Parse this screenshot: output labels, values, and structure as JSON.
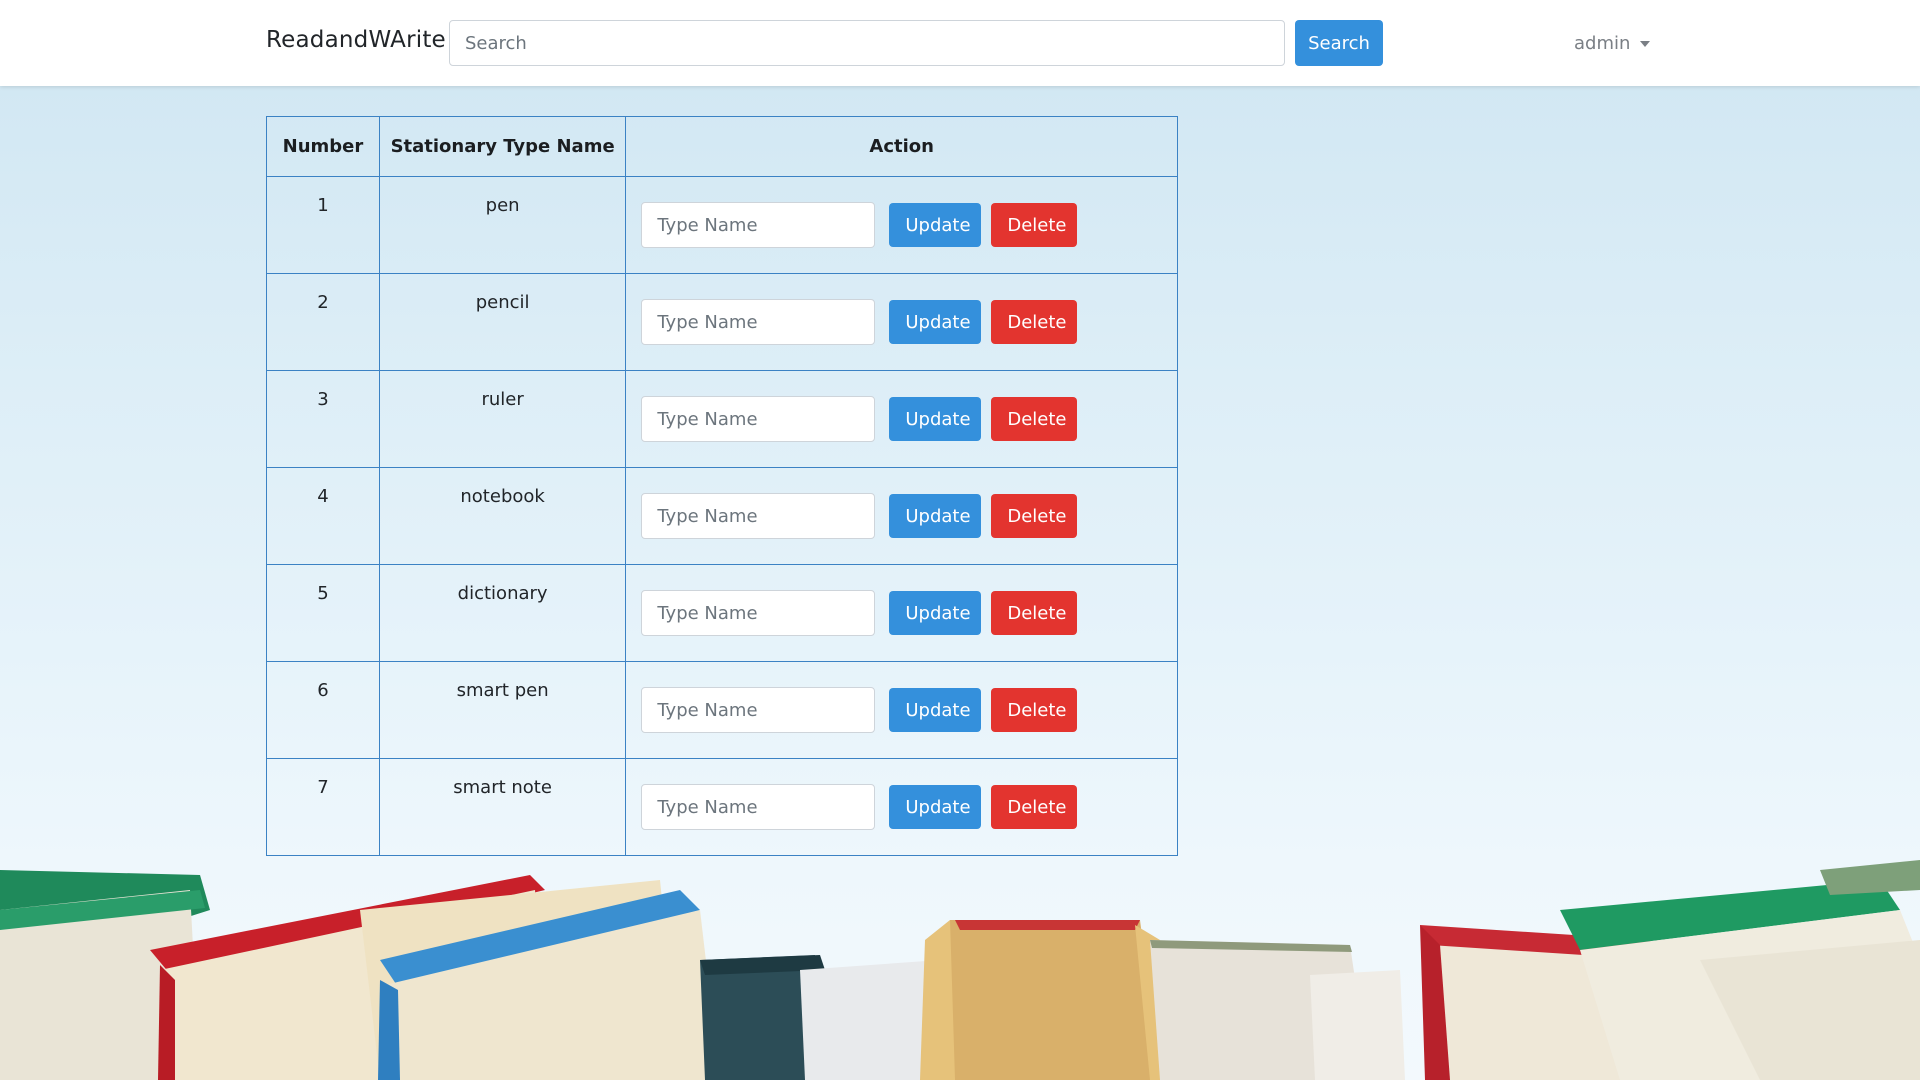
{
  "navbar": {
    "brand": "ReadandWArite",
    "search_placeholder": "Search",
    "search_button": "Search",
    "user": "admin"
  },
  "table": {
    "headers": [
      "Number",
      "Stationary Type Name",
      "Action"
    ],
    "input_placeholder": "Type Name",
    "update_label": "Update",
    "delete_label": "Delete",
    "rows": [
      {
        "number": "1",
        "name": "pen"
      },
      {
        "number": "2",
        "name": "pencil"
      },
      {
        "number": "3",
        "name": "ruler"
      },
      {
        "number": "4",
        "name": "notebook"
      },
      {
        "number": "5",
        "name": "dictionary"
      },
      {
        "number": "6",
        "name": "smart pen"
      },
      {
        "number": "7",
        "name": "smart note"
      }
    ]
  },
  "colors": {
    "primary": "#3490dc",
    "danger": "#e3342f",
    "border": "#3b82c4"
  }
}
